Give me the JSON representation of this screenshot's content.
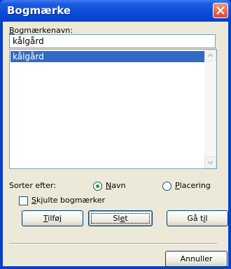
{
  "dialog": {
    "title": "Bogmærke",
    "name_label_prefix": "B",
    "name_label_rest": "ogmærkenavn:",
    "name_value": "kålgård",
    "bookmarks": [
      "kålgård"
    ],
    "sort_label": "Sorter efter:",
    "sort_options": [
      {
        "prefix": "",
        "accel": "N",
        "rest": "avn",
        "selected": true
      },
      {
        "prefix": "",
        "accel": "P",
        "rest": "lacering",
        "selected": false
      }
    ],
    "hide_checkbox": {
      "accel": "S",
      "rest": "kjulte bogmærker",
      "checked": false
    },
    "buttons": {
      "add": {
        "accel": "T",
        "rest": "ilføj"
      },
      "delete": {
        "pre": "Sl",
        "accel": "e",
        "rest": "t"
      },
      "goto": {
        "pre": "Gå t",
        "accel": "i",
        "rest": "l"
      },
      "cancel": "Annuller"
    }
  }
}
